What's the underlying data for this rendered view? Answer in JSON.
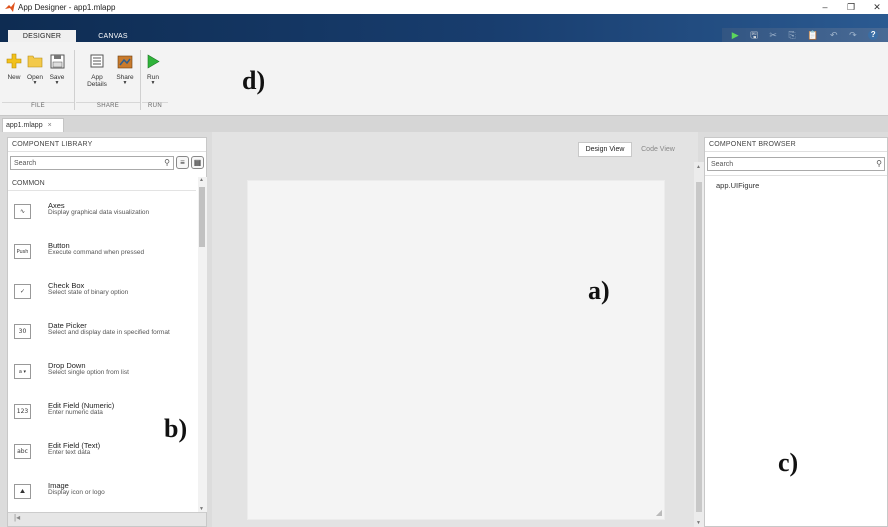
{
  "window": {
    "title": "App Designer - app1.mlapp",
    "minimize": "–",
    "maximize": "❐",
    "close": "✕"
  },
  "ribbon_tabs": [
    {
      "label": "DESIGNER"
    },
    {
      "label": "CANVAS"
    }
  ],
  "quick_access": [
    {
      "icon": "run-icon",
      "glyph": "▶"
    },
    {
      "icon": "save-icon",
      "glyph": "🖫"
    },
    {
      "icon": "cut-icon",
      "glyph": "✂"
    },
    {
      "icon": "copy-icon",
      "glyph": "⎘"
    },
    {
      "icon": "paste-icon",
      "glyph": "📋"
    },
    {
      "icon": "undo-icon",
      "glyph": "↶"
    },
    {
      "icon": "redo-icon",
      "glyph": "↷"
    },
    {
      "icon": "help-icon",
      "glyph": "?"
    }
  ],
  "toolstrip": {
    "file": {
      "group": "FILE",
      "new": "New",
      "open": "Open",
      "save": "Save"
    },
    "share": {
      "group": "SHARE",
      "details": "App\nDetails",
      "share": "Share"
    },
    "run": {
      "group": "RUN",
      "run": "Run"
    }
  },
  "annotations": {
    "a": "a)",
    "b": "b)",
    "c": "c)",
    "d": "d)"
  },
  "document_tab": {
    "label": "app1.mlapp",
    "close": "×"
  },
  "component_library": {
    "title": "COMPONENT LIBRARY",
    "search_placeholder": "Search",
    "section": "COMMON",
    "items": [
      {
        "name": "Axes",
        "desc": "Display graphical data visualization",
        "icon": "axes-icon",
        "glyph": "∿"
      },
      {
        "name": "Button",
        "desc": "Execute command when pressed",
        "icon": "button-icon",
        "glyph": "Push"
      },
      {
        "name": "Check Box",
        "desc": "Select state of binary option",
        "icon": "checkbox-icon",
        "glyph": "✓"
      },
      {
        "name": "Date Picker",
        "desc": "Select and display date in specified format",
        "icon": "calendar-icon",
        "glyph": "30"
      },
      {
        "name": "Drop Down",
        "desc": "Select single option from list",
        "icon": "dropdown-icon",
        "glyph": "a ▾"
      },
      {
        "name": "Edit Field (Numeric)",
        "desc": "Enter numeric data",
        "icon": "numeric-field-icon",
        "glyph": "123"
      },
      {
        "name": "Edit Field (Text)",
        "desc": "Enter text data",
        "icon": "text-field-icon",
        "glyph": "abc"
      },
      {
        "name": "Image",
        "desc": "Display icon or logo",
        "icon": "image-icon",
        "glyph": "⛰"
      }
    ],
    "collapse": "|◂"
  },
  "canvas": {
    "design_view": "Design View",
    "code_view": "Code View"
  },
  "component_browser": {
    "title": "COMPONENT BROWSER",
    "search_placeholder": "Search",
    "tree": [
      "app.UIFigure"
    ]
  }
}
